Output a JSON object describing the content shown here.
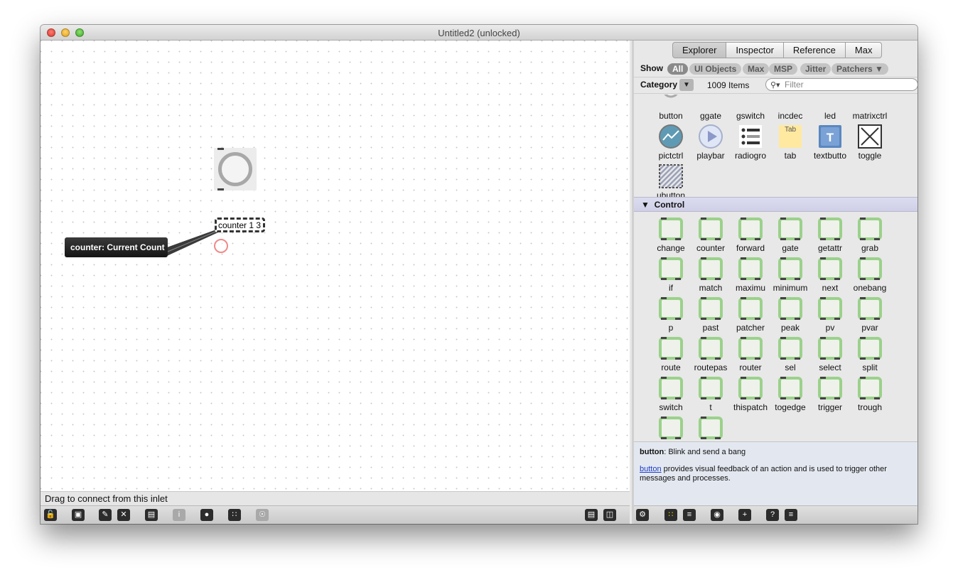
{
  "window": {
    "title": "Untitled2 (unlocked)"
  },
  "patcher": {
    "counter_object_text": "counter 1 3",
    "tooltip_text": "counter: Current Count",
    "status_text": "Drag to connect from this inlet"
  },
  "sidebar": {
    "tabs": [
      "Explorer",
      "Inspector",
      "Reference",
      "Max"
    ],
    "active_tab": "Explorer",
    "show_label": "Show",
    "show_filters": [
      "All",
      "UI Objects",
      "Max",
      "MSP",
      "Jitter",
      "Patchers ▼"
    ],
    "active_filter": "All",
    "category_label": "Category",
    "category_arrow": "▼",
    "item_count": "1009 Items",
    "filter_placeholder": "Filter",
    "ui_objects": [
      "button",
      "ggate",
      "gswitch",
      "incdec",
      "led",
      "matrixctrl",
      "pictctrl",
      "playbar",
      "radiogro",
      "tab",
      "textbutto",
      "toggle",
      "ubutton"
    ],
    "control_section": "Control",
    "control_objects": [
      "change",
      "counter",
      "forward",
      "gate",
      "getattr",
      "grab",
      "if",
      "match",
      "maximu",
      "minimum",
      "next",
      "onebang",
      "p",
      "past",
      "patcher",
      "peak",
      "pv",
      "pvar",
      "route",
      "routepas",
      "router",
      "sel",
      "select",
      "split",
      "switch",
      "t",
      "thispatch",
      "togedge",
      "trigger",
      "trough",
      "",
      ""
    ],
    "description": {
      "name": "button",
      "short": ": Blink and send a bang",
      "link": "button",
      "long": " provides visual feedback of an action and is used to trigger other messages and processes."
    }
  },
  "colors": {
    "led_red": "#e8102a",
    "tab_yellow": "#ffe9a0",
    "textbutton_blue": "#5b87c0",
    "object_green": "#9bd18b"
  },
  "toolbar_icons": [
    "lock-icon",
    "presentation-icon",
    "new-object-icon",
    "clear-icon",
    "paste-icon",
    "info-icon",
    "inspector-icon",
    "grid-icon",
    "debug-icon",
    "bottom-panel-icon",
    "sidebar-icon"
  ],
  "sidebar_toolbar_icons": [
    "gear-icon",
    "tile-view-icon",
    "list-view-icon",
    "eye-icon",
    "add-icon",
    "help-icon",
    "menu-icon"
  ]
}
